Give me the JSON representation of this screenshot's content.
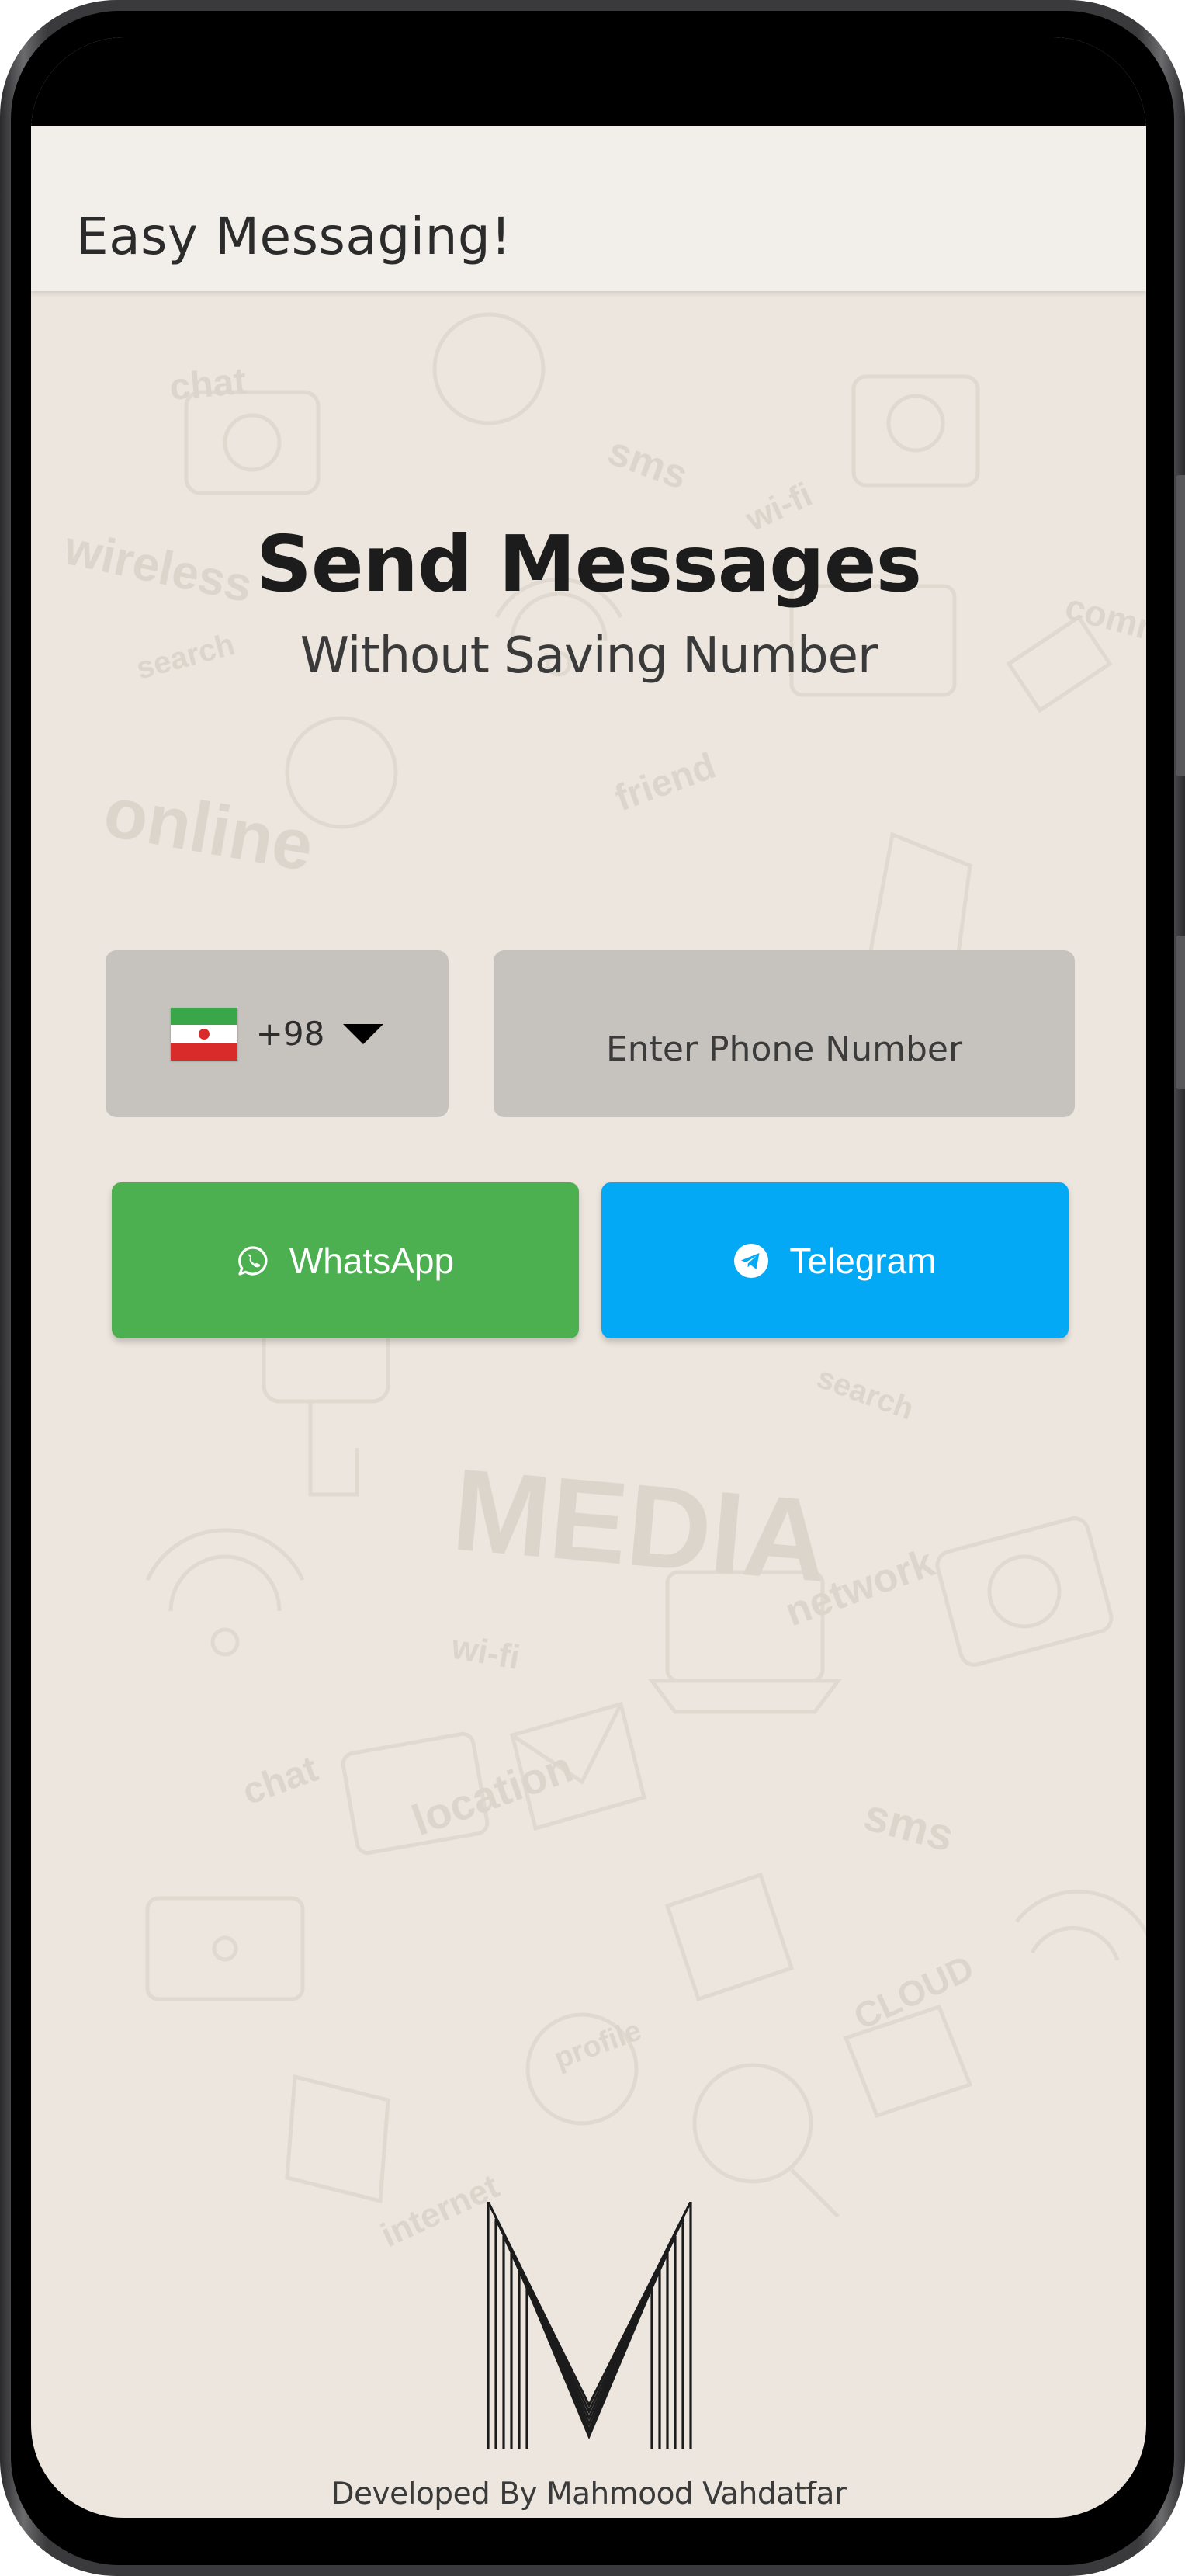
{
  "app": {
    "title": "Easy Messaging!"
  },
  "hero": {
    "heading": "Send Messages",
    "subheading": "Without Saving Number"
  },
  "country_picker": {
    "flag_icon": "iran-flag-icon",
    "dial_code": "+98",
    "dropdown_icon": "caret-down-icon"
  },
  "phone_input": {
    "value": "",
    "placeholder": "Enter Phone Number"
  },
  "actions": {
    "whatsapp": {
      "label": "WhatsApp",
      "icon": "whatsapp-icon",
      "color": "#4caf50"
    },
    "telegram": {
      "label": "Telegram",
      "icon": "telegram-icon",
      "color": "#03a9f4"
    }
  },
  "footer": {
    "logo_icon": "m-monogram-logo",
    "credit": "Developed By Mahmood Vahdatfar"
  },
  "colors": {
    "background": "#ece6de",
    "appbar": "#f2efeb",
    "field": "#c6c3be"
  }
}
